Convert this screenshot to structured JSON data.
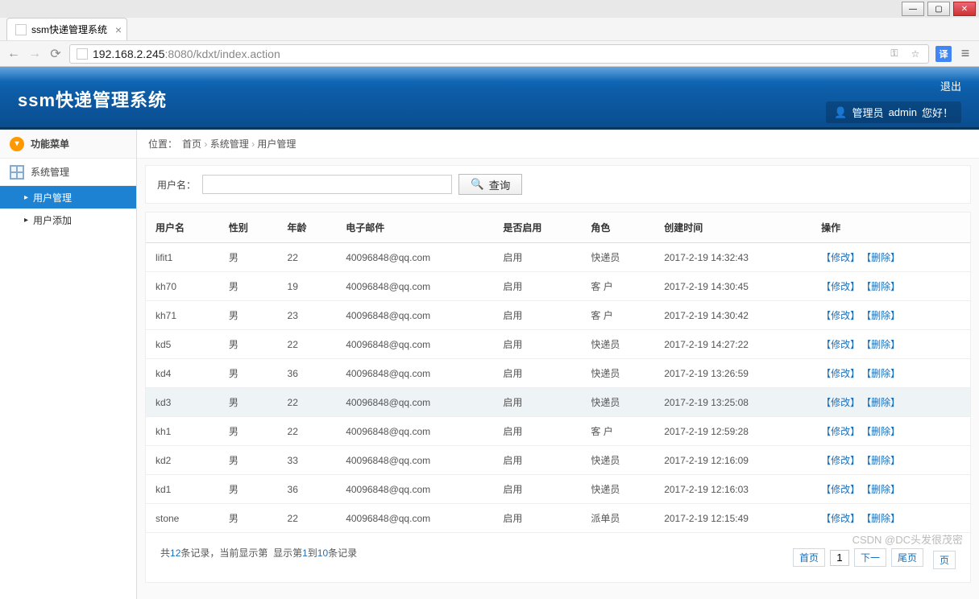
{
  "browser": {
    "tab_title": "ssm快递管理系统",
    "url_host": "192.168.2.245",
    "url_port_path": ":8080/kdxt/index.action",
    "translate_badge": "译"
  },
  "banner": {
    "title": "ssm快递管理系统",
    "logout": "退出",
    "welcome_prefix": "管理员",
    "welcome_user": "admin",
    "welcome_suffix": "您好！"
  },
  "sidebar": {
    "menu_title": "功能菜单",
    "section": "系统管理",
    "items": [
      {
        "label": "用户管理",
        "active": true
      },
      {
        "label": "用户添加",
        "active": false
      }
    ]
  },
  "breadcrumb": {
    "label": "位置：",
    "parts": [
      "首页",
      "系统管理",
      "用户管理"
    ]
  },
  "search": {
    "label": "用户名：",
    "value": "",
    "button": "查询"
  },
  "table": {
    "headers": [
      "用户名",
      "性别",
      "年龄",
      "电子邮件",
      "是否启用",
      "角色",
      "创建时间",
      "操作"
    ],
    "op_edit": "【修改】",
    "op_delete": "【删除】",
    "rows": [
      {
        "username": "lifit1",
        "gender": "男",
        "age": "22",
        "email": "40096848@qq.com",
        "enabled": "启用",
        "role": "快递员",
        "created": "2017-2-19 14:32:43"
      },
      {
        "username": "kh70",
        "gender": "男",
        "age": "19",
        "email": "40096848@qq.com",
        "enabled": "启用",
        "role": "客 户",
        "created": "2017-2-19 14:30:45"
      },
      {
        "username": "kh71",
        "gender": "男",
        "age": "23",
        "email": "40096848@qq.com",
        "enabled": "启用",
        "role": "客 户",
        "created": "2017-2-19 14:30:42"
      },
      {
        "username": "kd5",
        "gender": "男",
        "age": "22",
        "email": "40096848@qq.com",
        "enabled": "启用",
        "role": "快递员",
        "created": "2017-2-19 14:27:22"
      },
      {
        "username": "kd4",
        "gender": "男",
        "age": "36",
        "email": "40096848@qq.com",
        "enabled": "启用",
        "role": "快递员",
        "created": "2017-2-19 13:26:59"
      },
      {
        "username": "kd3",
        "gender": "男",
        "age": "22",
        "email": "40096848@qq.com",
        "enabled": "启用",
        "role": "快递员",
        "created": "2017-2-19 13:25:08",
        "hovered": true
      },
      {
        "username": "kh1",
        "gender": "男",
        "age": "22",
        "email": "40096848@qq.com",
        "enabled": "启用",
        "role": "客 户",
        "created": "2017-2-19 12:59:28"
      },
      {
        "username": "kd2",
        "gender": "男",
        "age": "33",
        "email": "40096848@qq.com",
        "enabled": "启用",
        "role": "快递员",
        "created": "2017-2-19 12:16:09"
      },
      {
        "username": "kd1",
        "gender": "男",
        "age": "36",
        "email": "40096848@qq.com",
        "enabled": "启用",
        "role": "快递员",
        "created": "2017-2-19 12:16:03"
      },
      {
        "username": "stone",
        "gender": "男",
        "age": "22",
        "email": "40096848@qq.com",
        "enabled": "启用",
        "role": "派单员",
        "created": "2017-2-19 12:15:49"
      }
    ]
  },
  "pager": {
    "info_p1": "共",
    "total": "12",
    "info_p2": "条记录，当前显示第",
    "info_p3": "显示第",
    "from": "1",
    "info_p4": "到",
    "to": "10",
    "info_p5": "条记录",
    "first": "首页",
    "current": "1",
    "next": "下一",
    "last": "尾页",
    "page_unit": "页"
  },
  "watermark": "CSDN @DC头发很茂密"
}
